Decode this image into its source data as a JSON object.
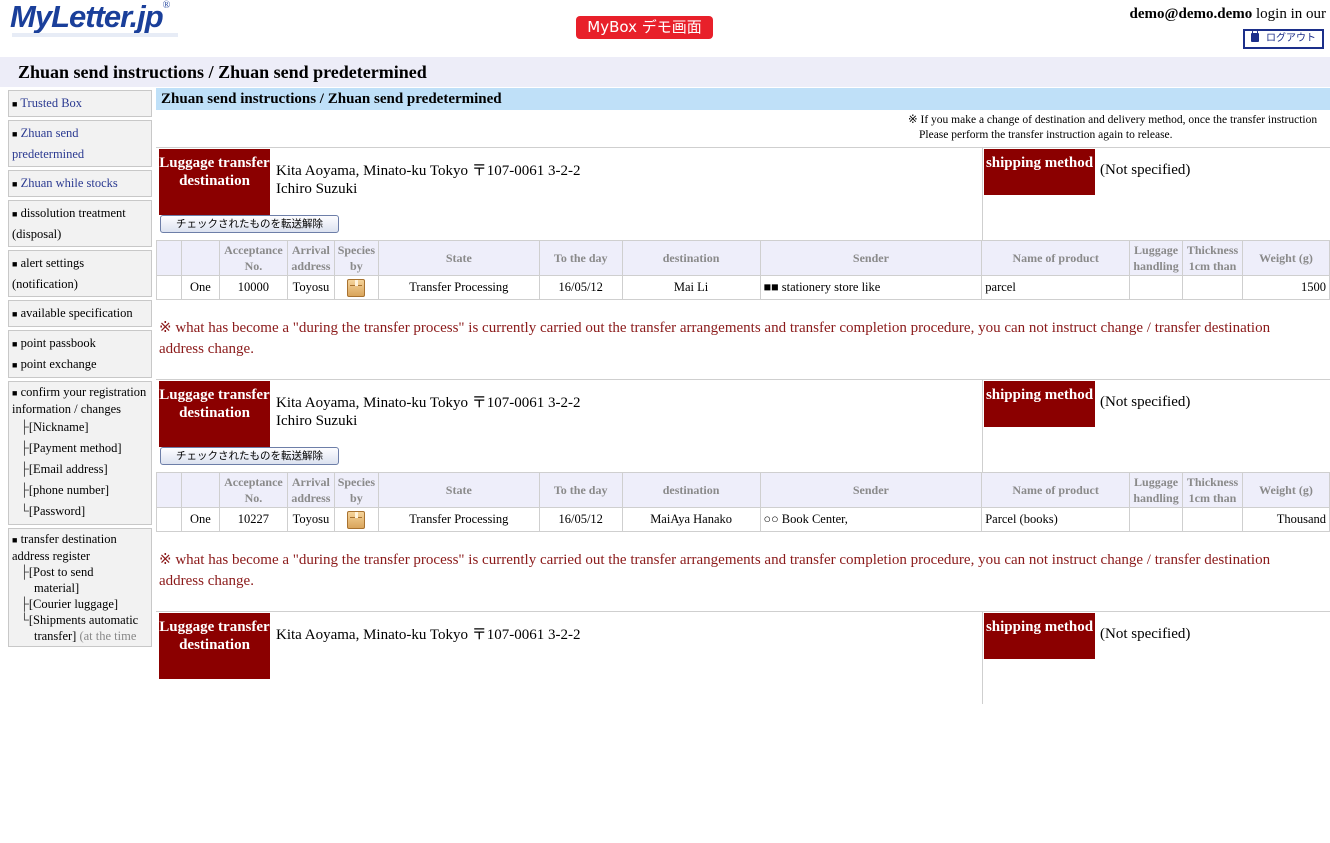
{
  "header": {
    "logo_text": "MyLetter.jp",
    "logo_reg": "®",
    "demo_badge": "MyBox デモ画面",
    "login_email": "demo@demo.demo",
    "login_suffix": " login in our",
    "logout_label": "ログアウト"
  },
  "page_heading": "Zhuan send instructions / Zhuan send predetermined",
  "sidebar": {
    "items": [
      {
        "label": "Trusted Box"
      },
      {
        "label": "Zhuan send predetermined"
      },
      {
        "label": "Zhuan while stocks"
      },
      {
        "label": "dissolution treatment (disposal)"
      },
      {
        "label": "alert settings (notification)"
      },
      {
        "label": "available specification"
      },
      {
        "label": "point passbook"
      },
      {
        "label": "point exchange"
      },
      {
        "label": "confirm your registration information / changes"
      },
      {
        "label": "transfer destination address register"
      }
    ],
    "sub_registration": [
      "[Nickname]",
      "[Payment method]",
      "[Email address]",
      "[phone number]",
      "[Password]"
    ],
    "sub_transfer": {
      "post": "[Post to send",
      "post2": "material]",
      "courier": "[Courier luggage]",
      "shipments": "[Shipments automatic",
      "shipments2": "transfer]",
      "shipments3": " (at the time"
    }
  },
  "main": {
    "section_title": "Zhuan send instructions / Zhuan send predetermined",
    "notice_line1": "※ If you make a change of destination and delivery method, once the transfer instruction",
    "notice_line2": "Please perform the transfer instruction again to release.",
    "dest_label": "Luggage transfer destination",
    "ship_label": "shipping method",
    "cancel_button": "チェックされたものを転送解除",
    "columns": {
      "acceptance": "Acceptance No.",
      "arrival": "Arrival address",
      "species": "Species by",
      "state": "State",
      "today": "To the day",
      "destination": "destination",
      "sender": "Sender",
      "product": "Name of product",
      "handling": "Luggage handling",
      "thickness": "Thickness 1cm than",
      "weight": "Weight (g)"
    },
    "warning": "※ what has become a \"during the transfer process\" is currently carried out the transfer arrangements and transfer completion procedure, you can not instruct change / transfer destination address change.",
    "blocks": [
      {
        "address": "Kita Aoyama, Minato-ku Tokyo 〒107-0061 3-2-2",
        "name": "Ichiro Suzuki",
        "shipping": "(Not specified)",
        "row": {
          "count": "One",
          "acceptance": "10000",
          "arrival": "Toyosu",
          "state": "Transfer Processing",
          "date": "16/05/12",
          "destination": "Mai Li",
          "sender": "■■ stationery store like",
          "product": "parcel",
          "weight": "1500"
        }
      },
      {
        "address": "Kita Aoyama, Minato-ku Tokyo 〒107-0061 3-2-2",
        "name": "Ichiro Suzuki",
        "shipping": "(Not specified)",
        "row": {
          "count": "One",
          "acceptance": "10227",
          "arrival": "Toyosu",
          "state": "Transfer Processing",
          "date": "16/05/12",
          "destination": "MaiAya Hanako",
          "sender": "○○ Book Center,",
          "product": "Parcel (books)",
          "weight": "Thousand"
        }
      },
      {
        "address": "Kita Aoyama, Minato-ku Tokyo 〒107-0061 3-2-2",
        "shipping": "(Not specified)"
      }
    ]
  }
}
